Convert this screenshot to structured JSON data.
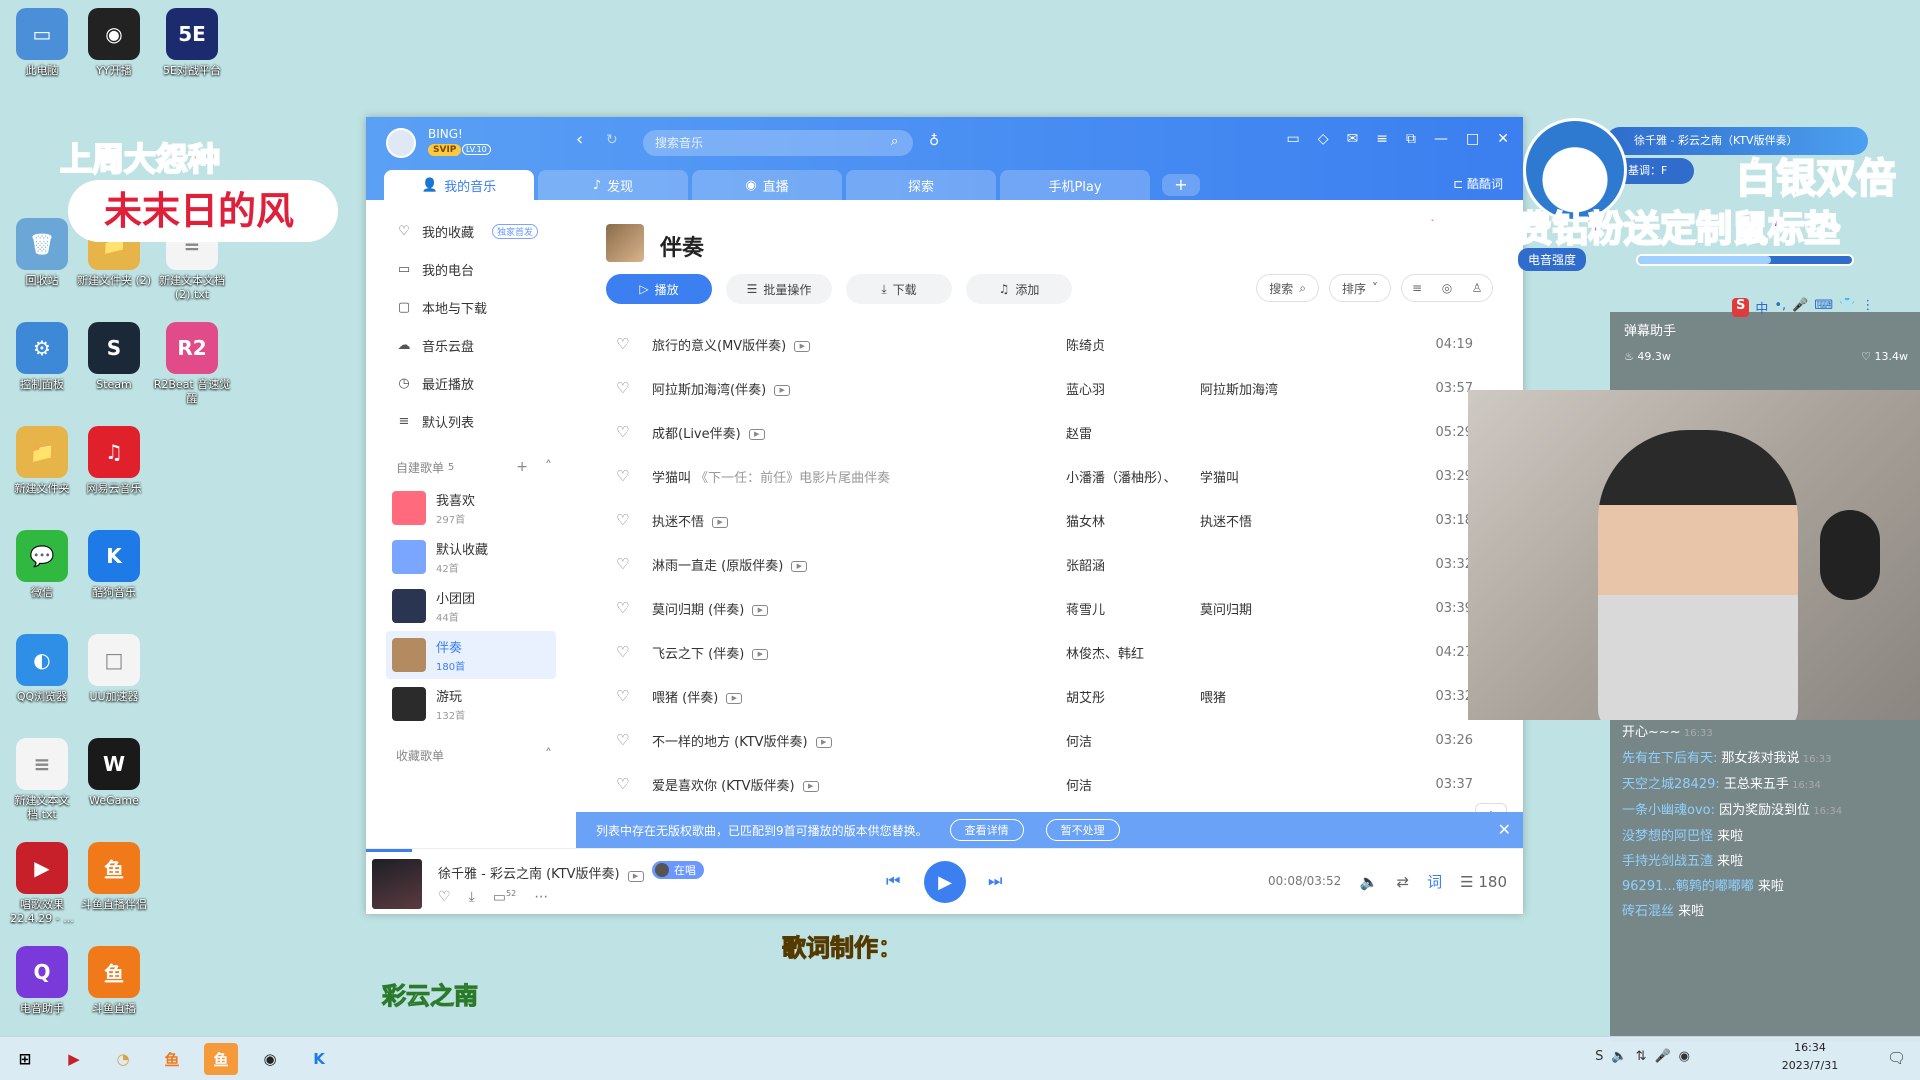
{
  "desktop": {
    "icons": [
      {
        "label": "此电脑",
        "glyph": "▭",
        "color": "#4b8fd9"
      },
      {
        "label": "YY开播",
        "glyph": "◉",
        "color": "#222222"
      },
      {
        "label": "5E对战平台",
        "glyph": "5E",
        "color": "#1b2b6e"
      },
      {
        "label": "回收站",
        "glyph": "🗑",
        "color": "#6aa7d6"
      },
      {
        "label": "新建文件夹 (2)",
        "glyph": "📁",
        "color": "#e7b44a"
      },
      {
        "label": "新建文本文档 (2).txt",
        "glyph": "≡",
        "color": "#f4f4f4"
      },
      {
        "label": "控制面板",
        "glyph": "⚙",
        "color": "#3d89d8"
      },
      {
        "label": "Steam",
        "glyph": "S",
        "color": "#1b2838"
      },
      {
        "label": "R2Beat 音速觉醒",
        "glyph": "R2",
        "color": "#e24b8a"
      },
      {
        "label": "新建文件夹",
        "glyph": "📁",
        "color": "#e7b44a"
      },
      {
        "label": "网易云音乐",
        "glyph": "♫",
        "color": "#e0202a"
      },
      {
        "label": "微信",
        "glyph": "💬",
        "color": "#30b840"
      },
      {
        "label": "酷狗音乐",
        "glyph": "K",
        "color": "#1e7ae6"
      },
      {
        "label": "QQ浏览器",
        "glyph": "◐",
        "color": "#2f8fe6"
      },
      {
        "label": "UU加速器",
        "glyph": "□",
        "color": "#f4f4f4"
      },
      {
        "label": "新建文本文档.txt",
        "glyph": "≡",
        "color": "#f4f4f4"
      },
      {
        "label": "WeGame",
        "glyph": "W",
        "color": "#1a1a1a"
      },
      {
        "label": "唱歌效果 22.4.29 - ...",
        "glyph": "▶",
        "color": "#c8202a"
      },
      {
        "label": "斗鱼直播伴侣",
        "glyph": "鱼",
        "color": "#f07a1a"
      },
      {
        "label": "电音助手",
        "glyph": "Q",
        "color": "#7a3ad9"
      },
      {
        "label": "斗鱼直播",
        "glyph": "鱼",
        "color": "#f07a1a"
      }
    ]
  },
  "banner_left": {
    "line1": "上周大怨种",
    "line2": "未末日的风"
  },
  "music_app": {
    "user": {
      "name": "BING!",
      "svip": "SVIP",
      "level": "LV.10"
    },
    "search": {
      "placeholder": "搜索音乐"
    },
    "tabs": [
      {
        "label": "我的音乐",
        "icon": "👤"
      },
      {
        "label": "发现",
        "icon": "♪"
      },
      {
        "label": "直播",
        "icon": "◉"
      },
      {
        "label": "探索",
        "icon": ""
      },
      {
        "label": "手机Play",
        "icon": ""
      }
    ],
    "tab_plus": "+",
    "tab_right": "酷酷词",
    "sidebar": {
      "items": [
        {
          "label": "我的收藏",
          "icon": "♡",
          "badge": "独家首发"
        },
        {
          "label": "我的电台",
          "icon": "▭",
          "badge": ""
        },
        {
          "label": "本地与下载",
          "icon": "▢",
          "badge": ""
        },
        {
          "label": "音乐云盘",
          "icon": "☁",
          "badge": ""
        },
        {
          "label": "最近播放",
          "icon": "◷",
          "badge": ""
        },
        {
          "label": "默认列表",
          "icon": "≡",
          "badge": ""
        }
      ],
      "custom_section": {
        "label": "自建歌单",
        "count": "5"
      },
      "playlists": [
        {
          "name": "我喜欢",
          "count": "297首",
          "color": "#ff6b7d"
        },
        {
          "name": "默认收藏",
          "count": "42首",
          "color": "#7aa6ff"
        },
        {
          "name": "小团团",
          "count": "44首",
          "color": "#2a3552"
        },
        {
          "name": "伴奏",
          "count": "180首",
          "color": "#b48a60"
        },
        {
          "name": "游玩",
          "count": "132首",
          "color": "#2b2b2b"
        }
      ],
      "collected_section": {
        "label": "收藏歌单"
      }
    },
    "playlist_header": {
      "title": "伴奏",
      "buttons": {
        "play": "播放",
        "batch": "批量操作",
        "download": "下载",
        "add": "添加"
      },
      "search": "搜索",
      "sort": "排序"
    },
    "songs": [
      {
        "title": "旅行的意义(MV版伴奏)",
        "sub": "",
        "artist": "陈绮贞",
        "album": "",
        "duration": "04:19"
      },
      {
        "title": "阿拉斯加海湾(伴奏)",
        "sub": "",
        "artist": "蓝心羽",
        "album": "阿拉斯加海湾",
        "duration": "03:57"
      },
      {
        "title": "成都(Live伴奏)",
        "sub": "",
        "artist": "赵雷",
        "album": "",
        "duration": "05:29"
      },
      {
        "title": "学猫叫",
        "sub": "《下一任：前任》电影片尾曲伴奏",
        "artist": "小潘潘（潘柚彤）、",
        "album": "学猫叫",
        "duration": "03:29"
      },
      {
        "title": "执迷不悟",
        "sub": "",
        "artist": "猫女林",
        "album": "执迷不悟",
        "duration": "03:18"
      },
      {
        "title": "淋雨一直走 (原版伴奏)",
        "sub": "",
        "artist": "张韶涵",
        "album": "",
        "duration": "03:32"
      },
      {
        "title": "莫问归期 (伴奏)",
        "sub": "",
        "artist": "蒋雪儿",
        "album": "莫问归期",
        "duration": "03:39"
      },
      {
        "title": "飞云之下 (伴奏)",
        "sub": "",
        "artist": "林俊杰、韩红",
        "album": "",
        "duration": "04:27"
      },
      {
        "title": "喂猪 (伴奏)",
        "sub": "",
        "artist": "胡艾彤",
        "album": "喂猪",
        "duration": "03:32"
      },
      {
        "title": "不一样的地方 (KTV版伴奏)",
        "sub": "",
        "artist": "何洁",
        "album": "",
        "duration": "03:26"
      },
      {
        "title": "爱是喜欢你 (KTV版伴奏)",
        "sub": "",
        "artist": "何洁",
        "album": "",
        "duration": "03:37"
      }
    ],
    "notice": {
      "text": "列表中存在无版权歌曲，已匹配到9首可播放的版本供您替换。",
      "detail": "查看详情",
      "ignore": "暂不处理"
    },
    "player": {
      "now_playing": "徐千雅 - 彩云之南 (KTV版伴奏)",
      "live_tag": "在唱",
      "comment_count": "52",
      "time": "00:08/03:52",
      "lyric_label": "词",
      "queue_count": "180",
      "progress_fraction": 0.04
    }
  },
  "live_overlay": {
    "song_chip": "徐千雅 - 彩云之南（KTV版伴奏）",
    "bgm_chip": "基调：F",
    "big_title": "白银双倍",
    "promo": "开通或续费钻粉送定制鼠标垫",
    "meter_label": "电音强度",
    "meter_fraction": 0.62
  },
  "danmu": {
    "title": "弹幕助手",
    "fire": "49.3w",
    "likes": "13.4w",
    "ime": [
      "S",
      "中",
      "•,",
      "🎤",
      "⌨",
      "👕",
      "⋮"
    ],
    "messages": [
      {
        "user": "",
        "text": "开心~~~",
        "time": "16:33"
      },
      {
        "user": "先有在下后有天: ",
        "text": "那女孩对我说",
        "time": "16:33"
      },
      {
        "user": "天空之城28429: ",
        "text": "王总来五手",
        "time": "16:34"
      },
      {
        "user": "一条小幽魂ovo: ",
        "text": "因为奖励没到位",
        "time": "16:34"
      },
      {
        "user": "没梦想的阿巴怪",
        "text": " 来啦",
        "time": ""
      },
      {
        "user": "手持光剑战五渣",
        "text": " 来啦",
        "time": ""
      },
      {
        "user": "96291...鹌鹑的嘟嘟嘟",
        "text": " 来啦",
        "time": ""
      },
      {
        "user": "砖石混丝",
        "text": " 来啦",
        "time": ""
      }
    ]
  },
  "captions": {
    "line1": "歌词制作：",
    "line2": "彩云之南"
  },
  "taskbar": {
    "apps": [
      {
        "glyph": "⊞",
        "color": "transparent",
        "active": false
      },
      {
        "glyph": "▶",
        "color": "#c8202a",
        "active": false
      },
      {
        "glyph": "◔",
        "color": "#d9a23a",
        "active": false
      },
      {
        "glyph": "鱼",
        "color": "#f07a1a",
        "active": false
      },
      {
        "glyph": "鱼",
        "color": "#f07a1a",
        "active": true
      },
      {
        "glyph": "◉",
        "color": "#222222",
        "active": false
      },
      {
        "glyph": "K",
        "color": "#1e7ae6",
        "active": false
      }
    ],
    "clock_time": "16:34",
    "clock_date": "2023/7/31"
  }
}
